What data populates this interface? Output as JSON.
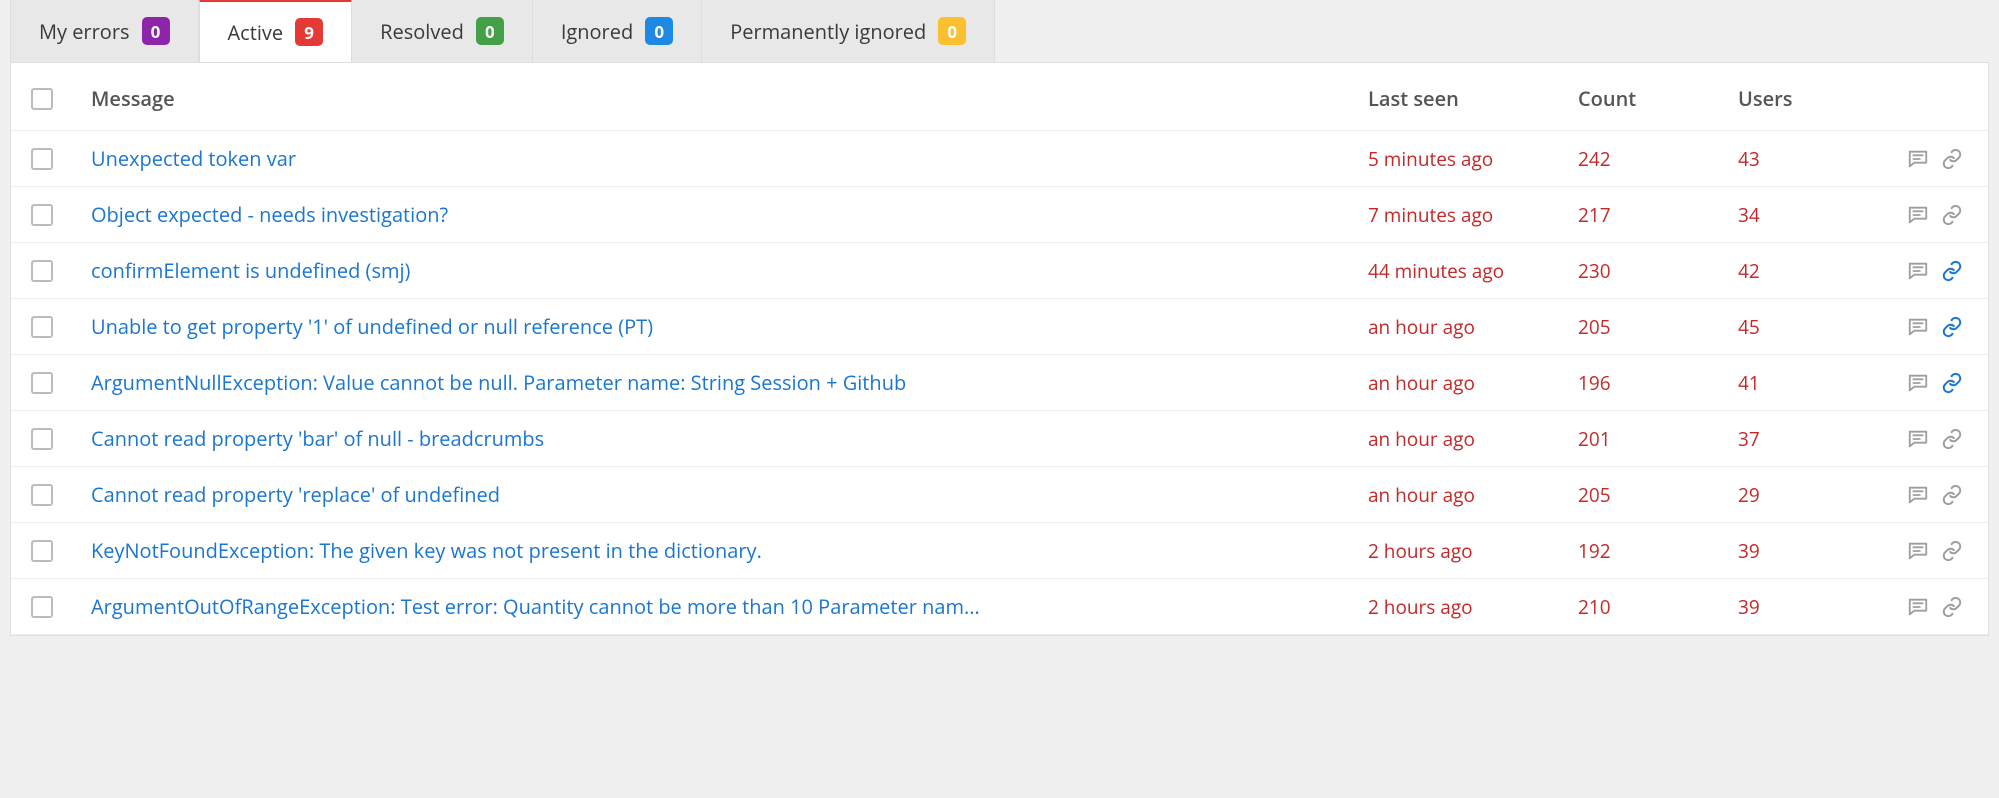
{
  "tabs": [
    {
      "label": "My errors",
      "count": "0",
      "badge_color": "purple",
      "active": false
    },
    {
      "label": "Active",
      "count": "9",
      "badge_color": "red",
      "active": true
    },
    {
      "label": "Resolved",
      "count": "0",
      "badge_color": "green",
      "active": false
    },
    {
      "label": "Ignored",
      "count": "0",
      "badge_color": "blue",
      "active": false
    },
    {
      "label": "Permanently ignored",
      "count": "0",
      "badge_color": "orange",
      "active": false
    }
  ],
  "columns": {
    "message": "Message",
    "last_seen": "Last seen",
    "count": "Count",
    "users": "Users"
  },
  "rows": [
    {
      "message": "Unexpected token var",
      "last_seen": "5 minutes ago",
      "count": "242",
      "users": "43",
      "link_highlight": false
    },
    {
      "message": "Object expected - needs investigation?",
      "last_seen": "7 minutes ago",
      "count": "217",
      "users": "34",
      "link_highlight": false
    },
    {
      "message": "confirmElement is undefined (smj)",
      "last_seen": "44 minutes ago",
      "count": "230",
      "users": "42",
      "link_highlight": true
    },
    {
      "message": "Unable to get property '1' of undefined or null reference (PT)",
      "last_seen": "an hour ago",
      "count": "205",
      "users": "45",
      "link_highlight": true
    },
    {
      "message": "ArgumentNullException: Value cannot be null. Parameter name: String Session + Github",
      "last_seen": "an hour ago",
      "count": "196",
      "users": "41",
      "link_highlight": true
    },
    {
      "message": "Cannot read property 'bar' of null - breadcrumbs",
      "last_seen": "an hour ago",
      "count": "201",
      "users": "37",
      "link_highlight": false
    },
    {
      "message": "Cannot read property 'replace' of undefined",
      "last_seen": "an hour ago",
      "count": "205",
      "users": "29",
      "link_highlight": false
    },
    {
      "message": "KeyNotFoundException: The given key was not present in the dictionary.",
      "last_seen": "2 hours ago",
      "count": "192",
      "users": "39",
      "link_highlight": false
    },
    {
      "message": "ArgumentOutOfRangeException: Test error: Quantity cannot be more than 10 Parameter nam...",
      "last_seen": "2 hours ago",
      "count": "210",
      "users": "39",
      "link_highlight": false
    }
  ]
}
